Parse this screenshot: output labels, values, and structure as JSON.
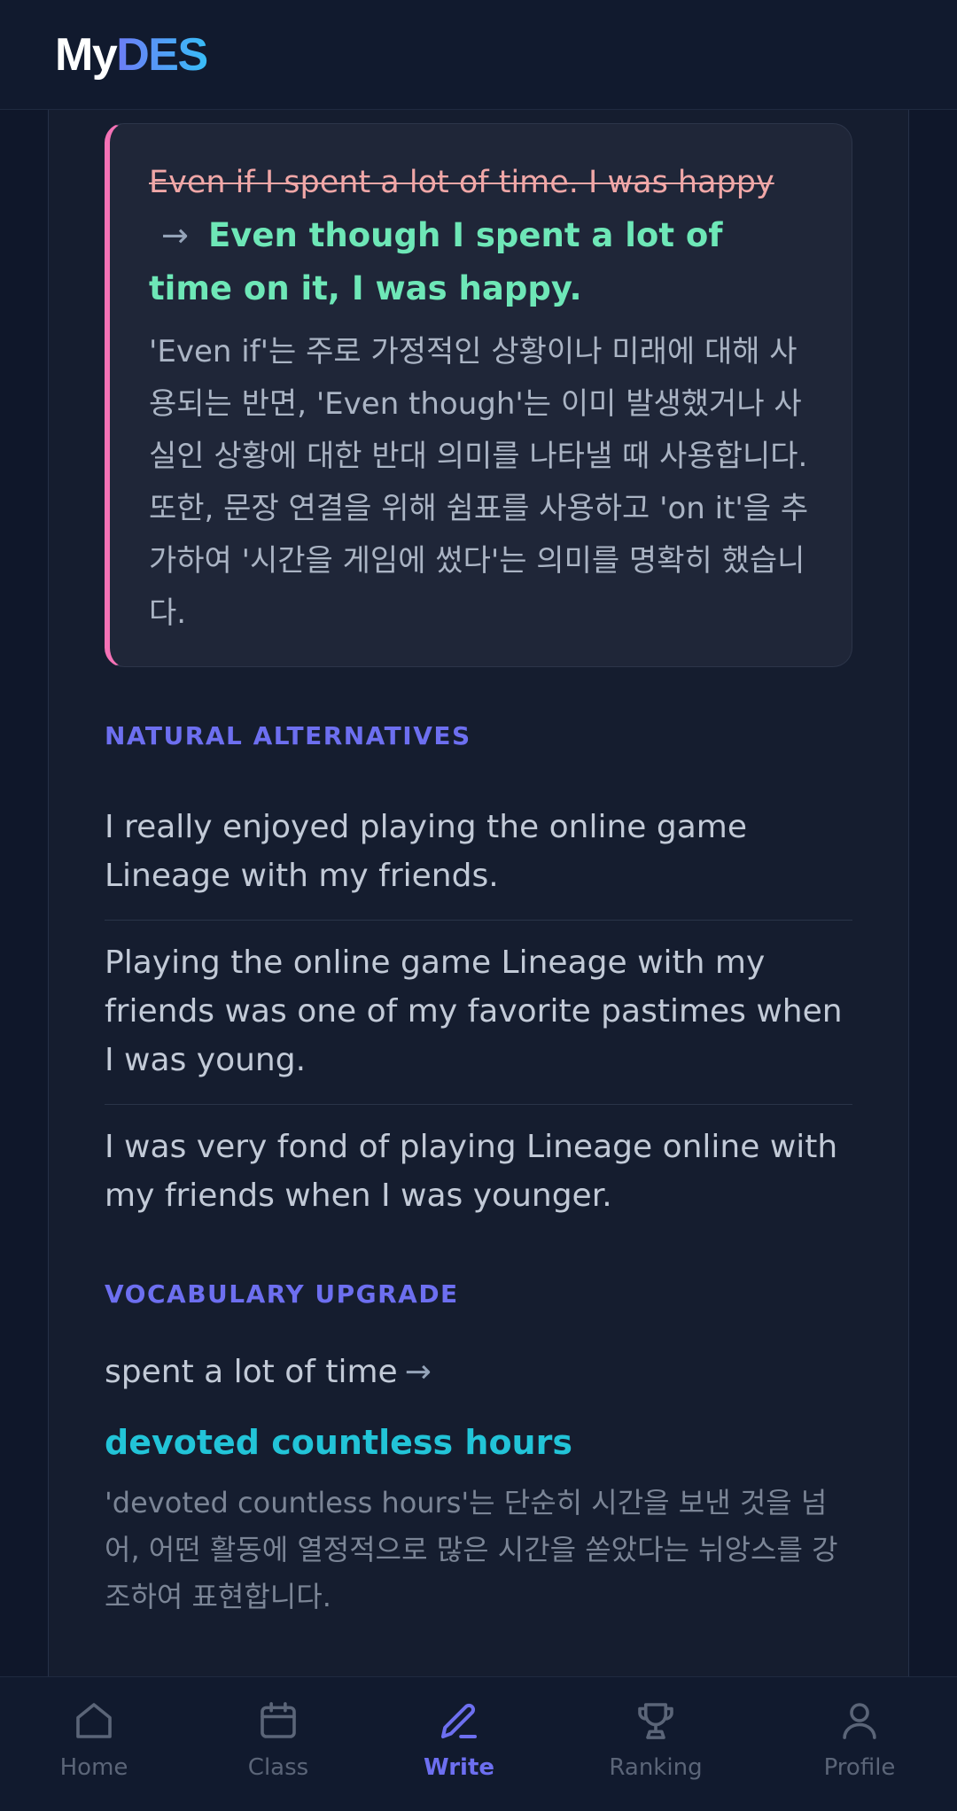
{
  "header": {
    "brand_my": "My",
    "brand_des": "DES",
    "brand_gradient": [
      "#6d7cf5",
      "#38bdf8"
    ]
  },
  "correction": {
    "original": "Even if I spent a lot of time. I was happy",
    "arrow": "→",
    "corrected": "Even though I spent a lot of time on it, I was happy.",
    "explanation": "'Even if'는 주로 가정적인 상황이나 미래에 대해 사용되는 반면, 'Even though'는 이미 발생했거나 사실인 상황에 대한 반대 의미를 나타낼 때 사용합니다. 또한, 문장 연결을 위해 쉼표를 사용하고 'on it'을 추가하여 '시간을 게임에 썼다'는 의미를 명확히 했습니다.",
    "accent_color": "#f472b6"
  },
  "natural_alternatives": {
    "label": "NATURAL ALTERNATIVES",
    "items": [
      "I really enjoyed playing the online game Lineage with my friends.",
      "Playing the online game Lineage with my friends was one of my favorite pastimes when I was young.",
      "I was very fond of playing Lineage online with my friends when I was younger."
    ]
  },
  "vocabulary_upgrade": {
    "label": "VOCABULARY UPGRADE",
    "from": "spent a lot of time",
    "arrow": "→",
    "to": "devoted countless hours",
    "explanation": "'devoted countless hours'는 단순히 시간을 보낸 것을 넘어, 어떤 활동에 열정적으로 많은 시간을 쏟았다는 뉘앙스를 강조하여 표현합니다."
  },
  "bottom_nav": {
    "active_color": "#6d6ff0",
    "items": [
      {
        "label": "Home",
        "icon": "home-icon"
      },
      {
        "label": "Class",
        "icon": "calendar-icon"
      },
      {
        "label": "Write",
        "icon": "pencil-icon",
        "active": true
      },
      {
        "label": "Ranking",
        "icon": "trophy-icon"
      },
      {
        "label": "Profile",
        "icon": "user-icon"
      }
    ]
  }
}
